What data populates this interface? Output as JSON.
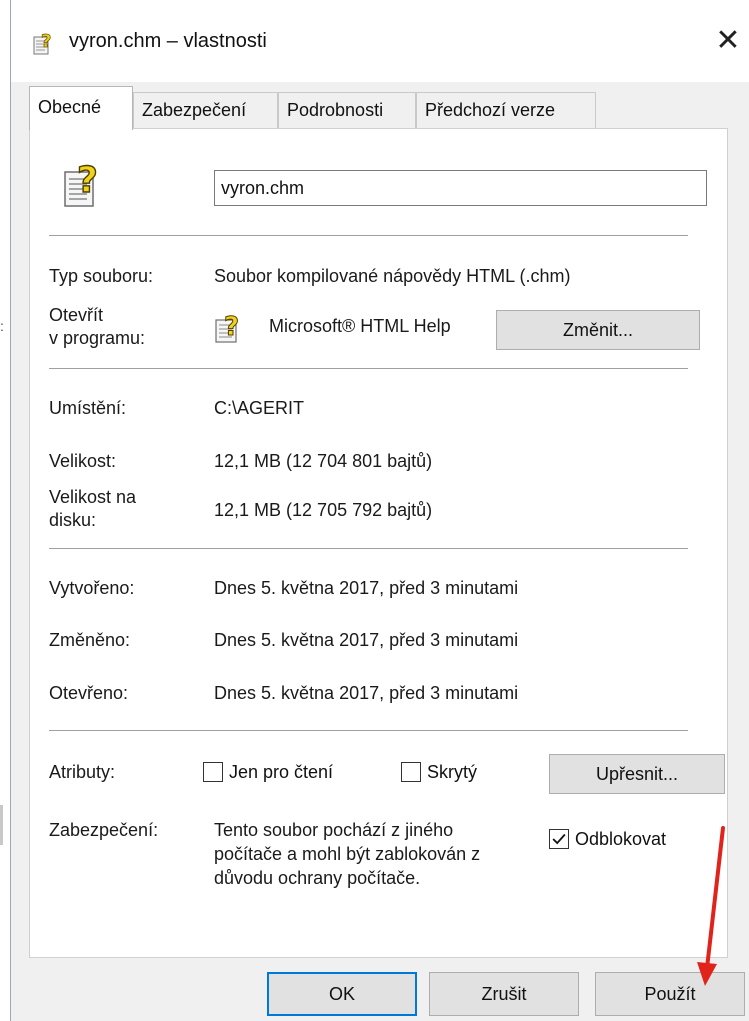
{
  "window": {
    "title": "vyron.chm – vlastnosti",
    "close_glyph": "✕"
  },
  "tabs": [
    {
      "label": "Obecné",
      "active": true
    },
    {
      "label": "Zabezpečení",
      "active": false
    },
    {
      "label": "Podrobnosti",
      "active": false
    },
    {
      "label": "Předchozí verze",
      "active": false
    }
  ],
  "general": {
    "file_name": "vyron.chm",
    "file_type_label": "Typ souboru:",
    "file_type_value": "Soubor kompilované nápovědy HTML (.chm)",
    "opens_with_label_line1": "Otevřít",
    "opens_with_label_line2": "v programu:",
    "opens_with_value": "Microsoft® HTML Help",
    "change_button": "Změnit...",
    "location_label": "Umístění:",
    "location_value": "C:\\AGERIT",
    "size_label": "Velikost:",
    "size_value": "12,1 MB (12 704 801 bajtů)",
    "size_on_disk_label_line1": "Velikost na",
    "size_on_disk_label_line2": "disku:",
    "size_on_disk_value": "12,1 MB (12 705 792 bajtů)",
    "created_label": "Vytvořeno:",
    "created_value": "Dnes 5. května 2017, před 3 minutami",
    "modified_label": "Změněno:",
    "modified_value": "Dnes 5. května 2017, před 3 minutami",
    "accessed_label": "Otevřeno:",
    "accessed_value": "Dnes 5. května 2017, před 3 minutami",
    "attributes_label": "Atributy:",
    "readonly_label": "Jen pro čtení",
    "readonly_checked": false,
    "hidden_label": "Skrytý",
    "hidden_checked": false,
    "advanced_button": "Upřesnit...",
    "security_label": "Zabezpečení:",
    "security_text_line1": "Tento soubor pochází z jiného",
    "security_text_line2": "počítače a mohl být zablokován z",
    "security_text_line3": "důvodu ochrany počítače.",
    "unblock_label": "Odblokovat",
    "unblock_checked": true
  },
  "footer": {
    "ok": "OK",
    "cancel": "Zrušit",
    "apply": "Použít"
  },
  "annotation": {
    "arrow_color": "#e0241c"
  },
  "colors": {
    "accent": "#0078d7",
    "button_face": "#e1e1e1",
    "panel_bg": "#ffffff",
    "window_bg": "#f0f0f0"
  }
}
